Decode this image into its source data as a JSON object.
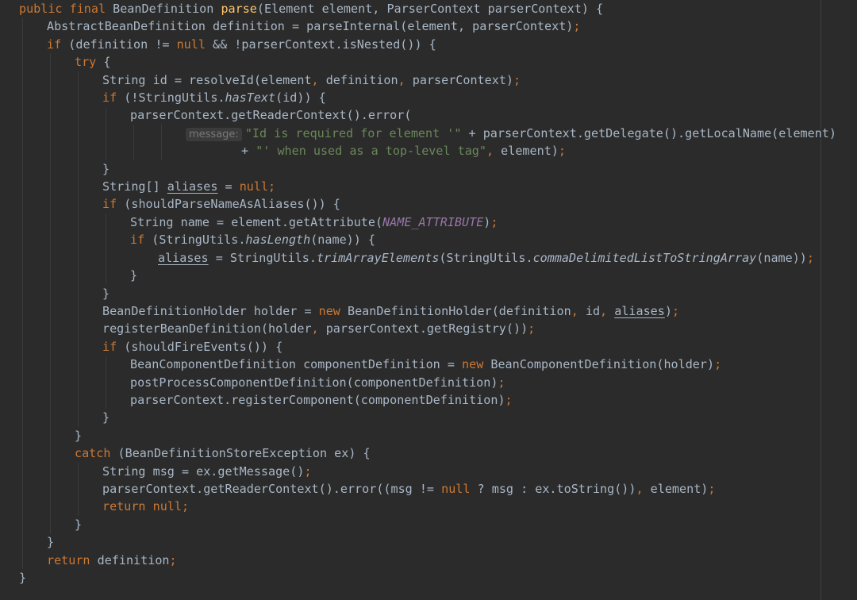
{
  "editor": {
    "language": "Java",
    "theme": "Darcula",
    "colors": {
      "background": "#2b2b2b",
      "default": "#a9b7c6",
      "keyword": "#cc7832",
      "method_declaration": "#ffc66d",
      "string": "#6a8759",
      "constant": "#9876aa",
      "inlay_hint": "#787878"
    },
    "lines": [
      {
        "indent": 0,
        "tokens": [
          {
            "t": "public final",
            "c": "kw"
          },
          {
            "t": " BeanDefinition "
          },
          {
            "t": "parse",
            "c": "fn"
          },
          {
            "t": "(Element element, ParserContext parserContext) {"
          }
        ]
      },
      {
        "indent": 1,
        "tokens": [
          {
            "t": "AbstractBeanDefinition definition = parseInternal(element, parserContext)"
          },
          {
            "t": ";",
            "c": "kw"
          }
        ]
      },
      {
        "indent": 1,
        "tokens": [
          {
            "t": "if",
            "c": "kw"
          },
          {
            "t": " (definition != "
          },
          {
            "t": "null",
            "c": "kw"
          },
          {
            "t": " && !parserContext.isNested()) {"
          }
        ]
      },
      {
        "indent": 2,
        "tokens": [
          {
            "t": "try",
            "c": "kw"
          },
          {
            "t": " {"
          }
        ]
      },
      {
        "indent": 3,
        "tokens": [
          {
            "t": "String id = resolveId(element"
          },
          {
            "t": ",",
            "c": "kw"
          },
          {
            "t": " definition"
          },
          {
            "t": ",",
            "c": "kw"
          },
          {
            "t": " parserContext)"
          },
          {
            "t": ";",
            "c": "kw"
          }
        ]
      },
      {
        "indent": 3,
        "tokens": [
          {
            "t": "if",
            "c": "kw"
          },
          {
            "t": " (!StringUtils."
          },
          {
            "t": "hasText",
            "c": "italic"
          },
          {
            "t": "(id)) {"
          }
        ]
      },
      {
        "indent": 4,
        "tokens": [
          {
            "t": "parserContext.getReaderContext().error("
          }
        ]
      },
      {
        "indent": 6,
        "tokens": [
          {
            "t": "message:",
            "c": "hint"
          },
          {
            "t": "\"Id is required for element '\"",
            "c": "st"
          },
          {
            "t": " + parserContext.getDelegate().getLocalName(element)"
          }
        ]
      },
      {
        "indent": 8,
        "tokens": [
          {
            "t": "+ "
          },
          {
            "t": "\"' when used as a top-level tag\"",
            "c": "st"
          },
          {
            "t": ",",
            "c": "kw"
          },
          {
            "t": " element)"
          },
          {
            "t": ";",
            "c": "kw"
          }
        ]
      },
      {
        "indent": 3,
        "tokens": [
          {
            "t": "}"
          }
        ]
      },
      {
        "indent": 3,
        "tokens": [
          {
            "t": "String[] "
          },
          {
            "t": "aliases",
            "c": "ul"
          },
          {
            "t": " = "
          },
          {
            "t": "null;",
            "c": "kw"
          }
        ]
      },
      {
        "indent": 3,
        "tokens": [
          {
            "t": "if",
            "c": "kw"
          },
          {
            "t": " (shouldParseNameAsAliases()) {"
          }
        ]
      },
      {
        "indent": 4,
        "tokens": [
          {
            "t": "String name = element.getAttribute("
          },
          {
            "t": "NAME_ATTRIBUTE",
            "c": "const"
          },
          {
            "t": ")"
          },
          {
            "t": ";",
            "c": "kw"
          }
        ]
      },
      {
        "indent": 4,
        "tokens": [
          {
            "t": "if",
            "c": "kw"
          },
          {
            "t": " (StringUtils."
          },
          {
            "t": "hasLength",
            "c": "italic"
          },
          {
            "t": "(name)) {"
          }
        ]
      },
      {
        "indent": 5,
        "tokens": [
          {
            "t": "aliases",
            "c": "ul"
          },
          {
            "t": " = StringUtils."
          },
          {
            "t": "trimArrayElements",
            "c": "italic"
          },
          {
            "t": "(StringUtils."
          },
          {
            "t": "commaDelimitedListToStringArray",
            "c": "italic"
          },
          {
            "t": "(name))"
          },
          {
            "t": ";",
            "c": "kw"
          }
        ]
      },
      {
        "indent": 4,
        "tokens": [
          {
            "t": "}"
          }
        ]
      },
      {
        "indent": 3,
        "tokens": [
          {
            "t": "}"
          }
        ]
      },
      {
        "indent": 3,
        "tokens": [
          {
            "t": "BeanDefinitionHolder holder = "
          },
          {
            "t": "new",
            "c": "kw"
          },
          {
            "t": " BeanDefinitionHolder(definition"
          },
          {
            "t": ",",
            "c": "kw"
          },
          {
            "t": " id"
          },
          {
            "t": ",",
            "c": "kw"
          },
          {
            "t": " "
          },
          {
            "t": "aliases",
            "c": "ul"
          },
          {
            "t": ")"
          },
          {
            "t": ";",
            "c": "kw"
          }
        ]
      },
      {
        "indent": 3,
        "tokens": [
          {
            "t": "registerBeanDefinition(holder"
          },
          {
            "t": ",",
            "c": "kw"
          },
          {
            "t": " parserContext.getRegistry())"
          },
          {
            "t": ";",
            "c": "kw"
          }
        ]
      },
      {
        "indent": 3,
        "tokens": [
          {
            "t": "if",
            "c": "kw"
          },
          {
            "t": " (shouldFireEvents()) {"
          }
        ]
      },
      {
        "indent": 4,
        "tokens": [
          {
            "t": "BeanComponentDefinition componentDefinition = "
          },
          {
            "t": "new",
            "c": "kw"
          },
          {
            "t": " BeanComponentDefinition(holder)"
          },
          {
            "t": ";",
            "c": "kw"
          }
        ]
      },
      {
        "indent": 4,
        "tokens": [
          {
            "t": "postProcessComponentDefinition(componentDefinition)"
          },
          {
            "t": ";",
            "c": "kw"
          }
        ]
      },
      {
        "indent": 4,
        "tokens": [
          {
            "t": "parserContext.registerComponent(componentDefinition)"
          },
          {
            "t": ";",
            "c": "kw"
          }
        ]
      },
      {
        "indent": 3,
        "tokens": [
          {
            "t": "}"
          }
        ]
      },
      {
        "indent": 2,
        "tokens": [
          {
            "t": "}"
          }
        ]
      },
      {
        "indent": 2,
        "tokens": [
          {
            "t": "catch",
            "c": "kw"
          },
          {
            "t": " (BeanDefinitionStoreException ex) {"
          }
        ]
      },
      {
        "indent": 3,
        "tokens": [
          {
            "t": "String msg = ex.getMessage()"
          },
          {
            "t": ";",
            "c": "kw"
          }
        ]
      },
      {
        "indent": 3,
        "tokens": [
          {
            "t": "parserContext.getReaderContext().error((msg != "
          },
          {
            "t": "null",
            "c": "kw"
          },
          {
            "t": " ? msg : ex.toString())"
          },
          {
            "t": ",",
            "c": "kw"
          },
          {
            "t": " element)"
          },
          {
            "t": ";",
            "c": "kw"
          }
        ]
      },
      {
        "indent": 3,
        "tokens": [
          {
            "t": "return null;",
            "c": "kw"
          }
        ]
      },
      {
        "indent": 2,
        "tokens": [
          {
            "t": "}"
          }
        ]
      },
      {
        "indent": 1,
        "tokens": [
          {
            "t": "}"
          }
        ]
      },
      {
        "indent": 1,
        "tokens": [
          {
            "t": "return",
            "c": "kw"
          },
          {
            "t": " definition"
          },
          {
            "t": ";",
            "c": "kw"
          }
        ]
      },
      {
        "indent": 0,
        "tokens": [
          {
            "t": "}"
          }
        ]
      }
    ]
  }
}
